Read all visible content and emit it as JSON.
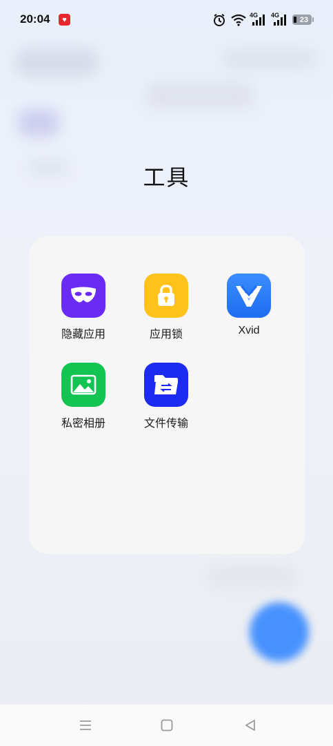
{
  "status_bar": {
    "time": "20:04",
    "battery": "23",
    "network_1": "4G",
    "network_2": "4G"
  },
  "folder": {
    "title": "工具",
    "apps": [
      {
        "label": "隐藏应用",
        "icon": "mask-icon",
        "color": "#6a2cf5"
      },
      {
        "label": "应用锁",
        "icon": "lock-icon",
        "color": "#ffc21a"
      },
      {
        "label": "Xvid",
        "icon": "xvid-logo-icon",
        "color": "#2a7df8"
      },
      {
        "label": "私密相册",
        "icon": "photo-icon",
        "color": "#14c453"
      },
      {
        "label": "文件传输",
        "icon": "folder-transfer-icon",
        "color": "#1d2bf0"
      }
    ]
  },
  "nav": {
    "menu_icon": "menu-icon",
    "home_icon": "home-icon",
    "back_icon": "back-icon"
  }
}
